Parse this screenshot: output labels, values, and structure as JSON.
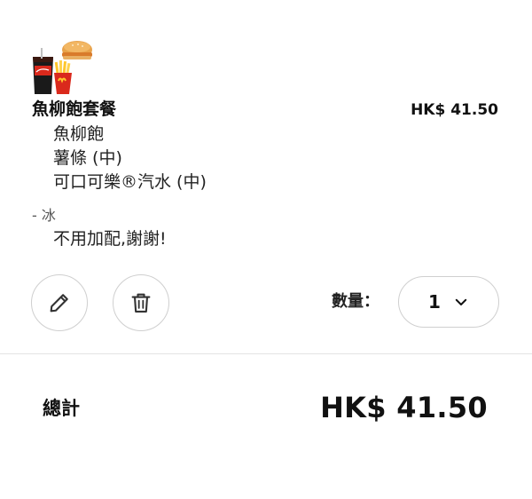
{
  "cart_item": {
    "image_icon": "meal-combo-icon",
    "name": "魚柳飽套餐",
    "price": "HK$ 41.50",
    "components": [
      "魚柳飽",
      "薯條 (中)",
      "可口可樂®汽水 (中)"
    ],
    "modifier_label": "- 冰",
    "modifier_value": "不用加配,謝謝!",
    "edit_icon": "pencil-icon",
    "delete_icon": "trash-icon",
    "quantity_label": "數量：",
    "quantity_value": "1",
    "quantity_dropdown_icon": "chevron-down-icon"
  },
  "summary": {
    "total_label": "總計",
    "total_value": "HK$ 41.50"
  },
  "colors": {
    "text": "#111111",
    "border": "#cfcfcf",
    "divider": "#e3e3e3",
    "mcdonalds_red": "#da291c",
    "mcdonalds_yellow": "#ffc72c"
  }
}
